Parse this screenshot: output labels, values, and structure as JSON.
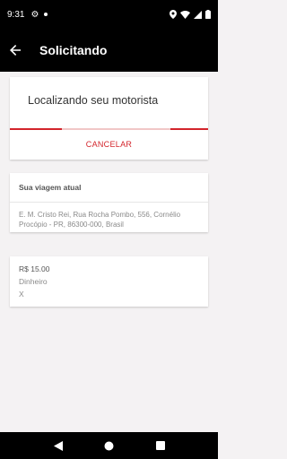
{
  "status_bar": {
    "time": "9:31",
    "icons": [
      "gear-icon",
      "notification-dot-icon",
      "location-icon",
      "wifi-icon",
      "signal-icon",
      "battery-icon"
    ]
  },
  "app_bar": {
    "title": "Solicitando",
    "back_icon": "arrow-back-icon"
  },
  "status_card": {
    "headline": "Localizando seu motorista",
    "cancel_label": "CANCELAR"
  },
  "trip_card": {
    "header": "Sua viagem atual",
    "address": "E. M. Cristo Rei, Rua Rocha Pombo, 556, Cornélio Procópio - PR, 86300-000, Brasil"
  },
  "payment_card": {
    "price": "R$ 15.00",
    "method": "Dinheiro",
    "extra": "X"
  },
  "nav_bar": {
    "icons": [
      "back-triangle-icon",
      "home-circle-icon",
      "recents-square-icon"
    ]
  },
  "colors": {
    "accent": "#d3242b",
    "app_bar": "#000000",
    "background": "#f4f2f3"
  }
}
